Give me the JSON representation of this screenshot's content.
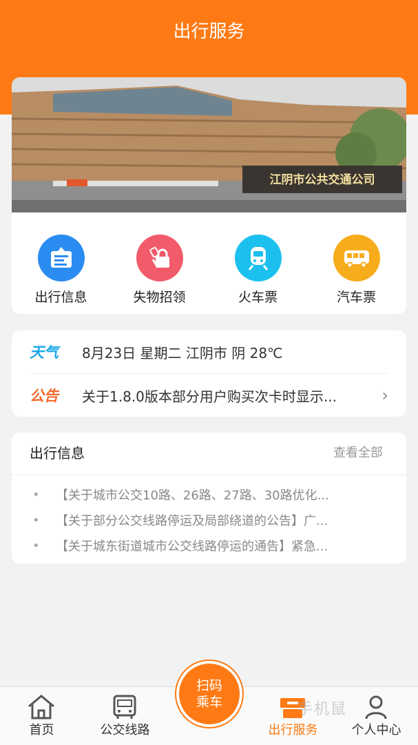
{
  "header": {
    "title": "出行服务"
  },
  "banner": {
    "sign_text": "江阴市公共交通公司"
  },
  "services": [
    {
      "label": "出行信息",
      "icon": "info-board-icon",
      "color": "#2a8cf0"
    },
    {
      "label": "失物招领",
      "icon": "lost-found-icon",
      "color": "#f25b6a"
    },
    {
      "label": "火车票",
      "icon": "train-icon",
      "color": "#1cc0ee"
    },
    {
      "label": "汽车票",
      "icon": "bus-icon",
      "color": "#f7ac1c"
    }
  ],
  "weather": {
    "badge": "天气",
    "text": "8月23日 星期二 江阴市 阴 28℃",
    "color": "#1aa7e8"
  },
  "notice": {
    "badge": "公告",
    "text": "关于1.8.0版本部分用户购买次卡时显示...",
    "color": "#f36b2c"
  },
  "news": {
    "title": "出行信息",
    "view_all": "查看全部",
    "items": [
      "【关于城市公交10路、26路、27路、30路优化...",
      "【关于部分公交线路停运及局部绕道的公告】广...",
      "【关于城东街道城市公交线路停运的通告】紧急..."
    ]
  },
  "tabs": [
    {
      "label": "首页",
      "icon": "home-icon"
    },
    {
      "label": "公交线路",
      "icon": "bus-route-icon"
    },
    {
      "label": "出行服务",
      "icon": "travel-service-icon",
      "active": true
    },
    {
      "label": "个人中心",
      "icon": "person-icon"
    }
  ],
  "scan": {
    "line1": "扫码",
    "line2": "乘车"
  },
  "watermark": "手机鼠",
  "colors": {
    "accent": "#ff7a14",
    "background": "#f2f2f2"
  }
}
